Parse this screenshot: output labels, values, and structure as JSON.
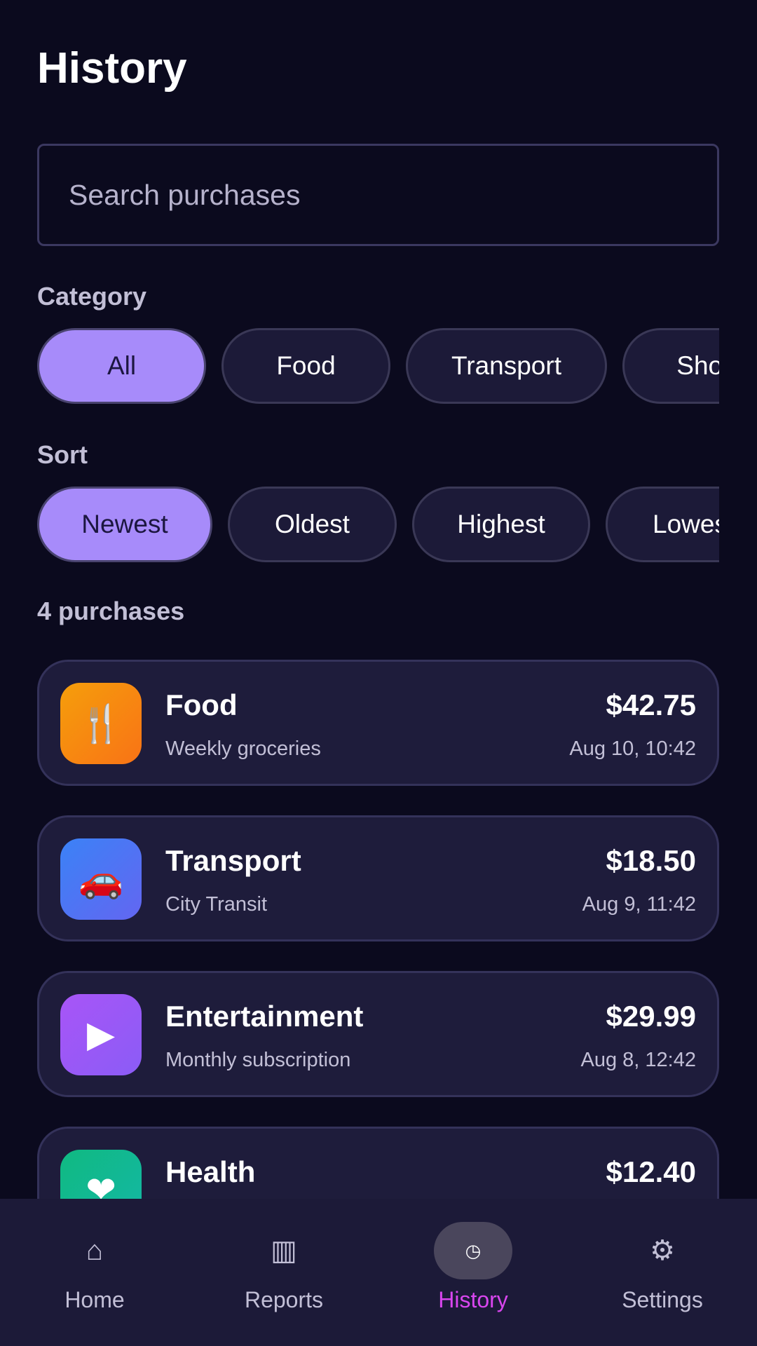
{
  "header": {
    "title": "History"
  },
  "search": {
    "placeholder": "Search purchases",
    "value": ""
  },
  "category_filter": {
    "label": "Category",
    "chips": [
      "All",
      "Food",
      "Transport",
      "Shop"
    ],
    "selected": "All"
  },
  "sort_filter": {
    "label": "Sort",
    "chips": [
      "Newest",
      "Oldest",
      "Highest",
      "Lowes"
    ],
    "selected": "Newest"
  },
  "purchases_count": "4 purchases",
  "purchases": [
    {
      "category": "Food",
      "note": "Weekly groceries",
      "amount": "$42.75",
      "date": "Aug 10, 10:42",
      "icon": "fork-knife-icon",
      "glyph": "🍴",
      "colors": [
        "#f59e0b",
        "#f97316"
      ]
    },
    {
      "category": "Transport",
      "note": "City Transit",
      "amount": "$18.50",
      "date": "Aug 9, 11:42",
      "icon": "car-icon",
      "glyph": "🚗",
      "colors": [
        "#3b82f6",
        "#6366f1"
      ]
    },
    {
      "category": "Entertainment",
      "note": "Monthly subscription",
      "amount": "$29.99",
      "date": "Aug 8, 12:42",
      "icon": "play-icon",
      "glyph": "▶",
      "colors": [
        "#a855f7",
        "#8b5cf6"
      ]
    },
    {
      "category": "Health",
      "note": "",
      "amount": "$12.40",
      "date": "",
      "icon": "heart-icon",
      "glyph": "❤",
      "colors": [
        "#10b981",
        "#14b8a6"
      ]
    }
  ],
  "nav": {
    "items": [
      {
        "label": "Home",
        "icon": "home-icon",
        "glyph": "⌂"
      },
      {
        "label": "Reports",
        "icon": "reports-icon",
        "glyph": "▥"
      },
      {
        "label": "History",
        "icon": "history-icon",
        "glyph": "◷"
      },
      {
        "label": "Settings",
        "icon": "settings-icon",
        "glyph": "⚙"
      }
    ],
    "active": "History"
  }
}
